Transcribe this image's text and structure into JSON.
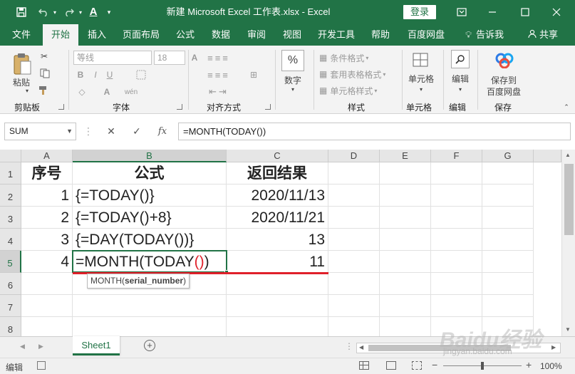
{
  "window": {
    "title": "新建 Microsoft Excel 工作表.xlsx  -  Excel",
    "login_label": "登录",
    "icons": [
      "save-icon",
      "undo-icon",
      "redo-icon",
      "font-color-icon",
      "customize-icon",
      "ribbon-display-icon",
      "minimize-icon",
      "maximize-icon",
      "close-icon"
    ]
  },
  "menu": {
    "tabs": [
      "文件",
      "开始",
      "插入",
      "页面布局",
      "公式",
      "数据",
      "审阅",
      "视图",
      "开发工具",
      "帮助",
      "百度网盘"
    ],
    "active_tab": "开始",
    "tell_me": "告诉我",
    "share": "共享"
  },
  "ribbon": {
    "paste_label": "粘贴",
    "font_name": "等线",
    "font_size": "18",
    "groups": [
      "剪贴板",
      "字体",
      "对齐方式",
      "数字",
      "样式",
      "单元格",
      "编辑",
      "保存"
    ],
    "number_label": "数字",
    "number_symbol": "%",
    "styles": [
      "条件格式",
      "套用表格格式",
      "单元格样式"
    ],
    "cells_label": "单元格",
    "edit_label": "编辑",
    "save_baidu_line1": "保存到",
    "save_baidu_line2": "百度网盘"
  },
  "formula_bar": {
    "name_box": "SUM",
    "fx_label": "fx",
    "formula": "=MONTH(TODAY())"
  },
  "sheet": {
    "columns": [
      "A",
      "B",
      "C",
      "D",
      "E",
      "F",
      "G"
    ],
    "selected_column": "B",
    "rows": [
      "1",
      "2",
      "3",
      "4",
      "5",
      "6",
      "7",
      "8"
    ],
    "selected_row": "5",
    "headers": [
      "序号",
      "公式",
      "返回结果"
    ],
    "data": [
      {
        "no": "1",
        "formula": "{=TODAY()}",
        "result": "2020/11/13"
      },
      {
        "no": "2",
        "formula": "{=TODAY()+8}",
        "result": "2020/11/21"
      },
      {
        "no": "3",
        "formula": "{=DAY(TODAY())}",
        "result": "13"
      },
      {
        "no": "4",
        "formula": "=MONTH(TODAY())",
        "result": "11"
      }
    ],
    "editing_prefix": "=MONTH(TODAY",
    "editing_parens": "()",
    "editing_suffix": ")",
    "tooltip_func": "MONTH(",
    "tooltip_arg": "serial_number",
    "tooltip_close": ")"
  },
  "sheet_tabs": {
    "active": "Sheet1",
    "add_label": "+"
  },
  "status": {
    "mode": "编辑",
    "zoom": "100%"
  },
  "watermark": {
    "brand": "Baidu经验",
    "url": "jingyan.baidu.com"
  },
  "colors": {
    "accent": "#217346",
    "underline": "#e0202a",
    "paren": "#e0202a"
  }
}
